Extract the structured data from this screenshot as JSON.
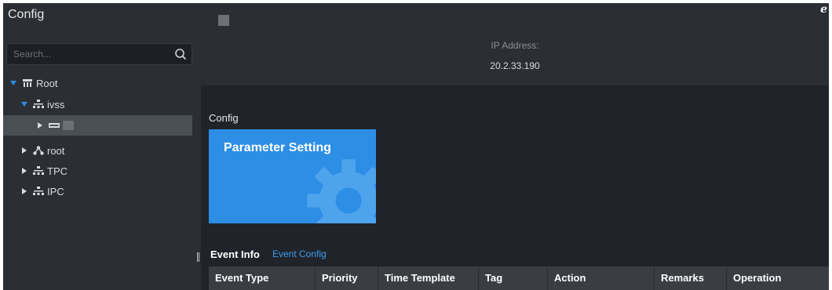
{
  "sidebar": {
    "title": "Config",
    "search": {
      "placeholder": "Search...",
      "value": ""
    },
    "tree": [
      {
        "label": "Root",
        "icon": "server-rack-icon",
        "expanded": true
      },
      {
        "label": "ivss",
        "icon": "network-icon",
        "expanded": true
      },
      {
        "label": "",
        "icon": "device-icon",
        "expanded": false,
        "selected": true
      },
      {
        "label": "root",
        "icon": "org-node-icon",
        "expanded": false
      },
      {
        "label": "TPC",
        "icon": "network-icon",
        "expanded": false
      },
      {
        "label": "IPC",
        "icon": "network-icon",
        "expanded": false
      }
    ]
  },
  "header": {
    "ip_label": "IP Address:",
    "ip_value": "20.2.33.190",
    "browser_icon": "e"
  },
  "config": {
    "section_title": "Config",
    "tile_label": "Parameter Setting"
  },
  "events": {
    "title": "Event Info",
    "link": "Event Config",
    "columns": [
      "Event Type",
      "Priority",
      "Time Template",
      "Tag",
      "Action",
      "Remarks",
      "Operation"
    ]
  },
  "colors": {
    "accent": "#2d8ee6",
    "link": "#3c9cf0",
    "tree_caret": "#2d8ee6"
  }
}
